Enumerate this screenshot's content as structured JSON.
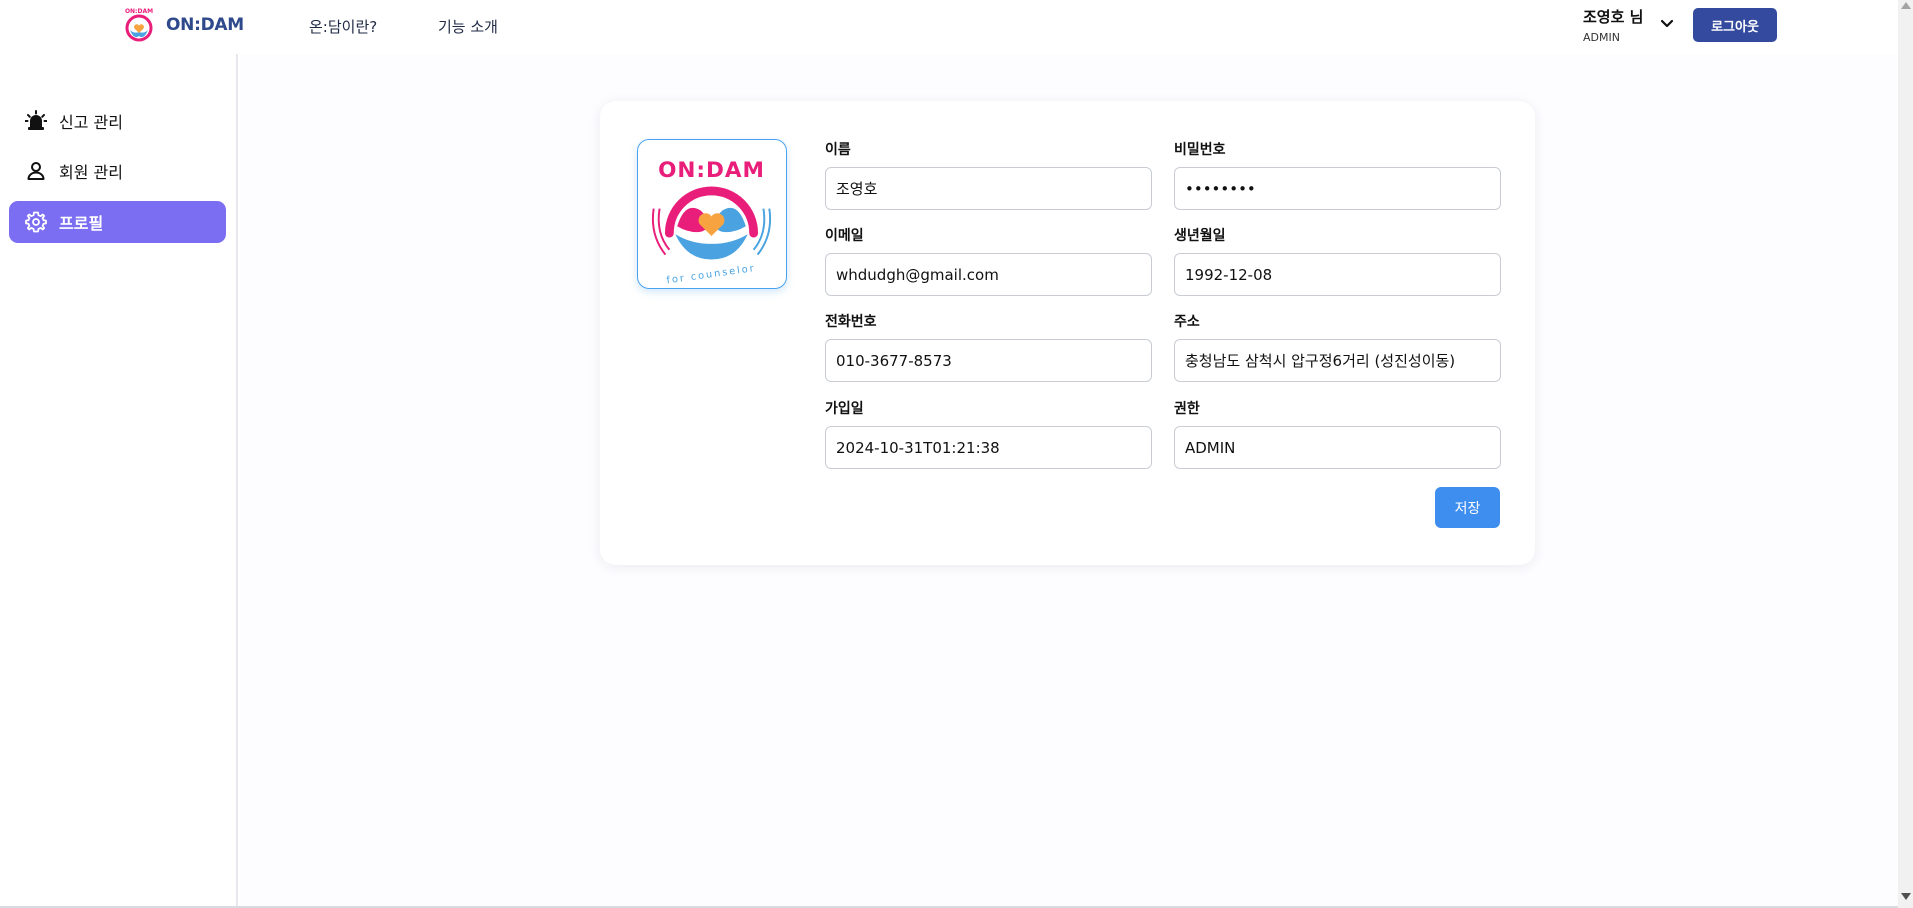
{
  "header": {
    "brand_name": "ON:DAM",
    "logo_text": "ON:DAM",
    "nav": [
      {
        "label": "온:담이란?"
      },
      {
        "label": "기능 소개"
      }
    ],
    "user": {
      "name": "조영호 님",
      "role": "ADMIN"
    },
    "logout_label": "로그아웃"
  },
  "sidebar": {
    "items": [
      {
        "label": "신고 관리",
        "icon": "siren-icon"
      },
      {
        "label": "회원 관리",
        "icon": "user-icon"
      },
      {
        "label": "프로필",
        "icon": "gear-icon",
        "active": true
      }
    ]
  },
  "profile": {
    "logo_text_top": "ON:DAM",
    "logo_text_bottom": "for counselor",
    "fields": {
      "name": {
        "label": "이름",
        "value": "조영호"
      },
      "password": {
        "label": "비밀번호",
        "value": "••••••••"
      },
      "email": {
        "label": "이메일",
        "value": "whdudgh@gmail.com"
      },
      "birth": {
        "label": "생년월일",
        "value": "1992-12-08"
      },
      "phone": {
        "label": "전화번호",
        "value": "010-3677-8573"
      },
      "address": {
        "label": "주소",
        "value": "충청남도 삼척시 압구정6거리 (성진성이동)"
      },
      "joined": {
        "label": "가입일",
        "value": "2024-10-31T01:21:38"
      },
      "role": {
        "label": "권한",
        "value": "ADMIN"
      }
    },
    "save_label": "저장"
  },
  "colors": {
    "brand_navy": "#2f4a8c",
    "logout_bg": "#334a9e",
    "sidebar_active": "#7b6ef2",
    "save_button": "#3e8ef0",
    "logo_pink": "#e91e7a",
    "logo_blue": "#4aa3e0",
    "logo_heart": "#f7a440"
  }
}
